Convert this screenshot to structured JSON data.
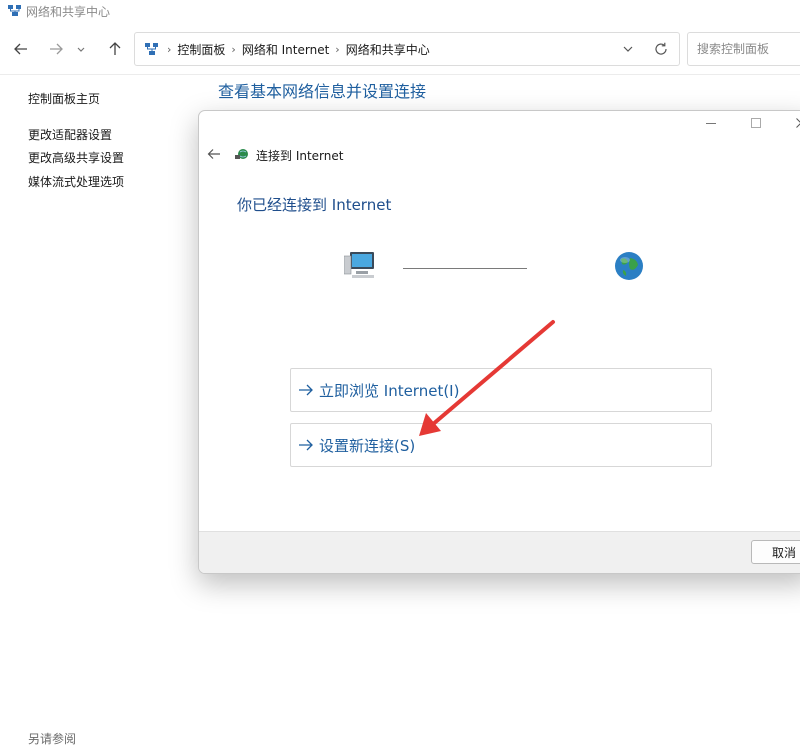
{
  "window": {
    "title": "网络和共享中心"
  },
  "toolbar": {
    "back_icon": "arrow-left-icon",
    "forward_icon": "arrow-right-icon",
    "recent_icon": "chevron-down-icon",
    "up_icon": "arrow-up-icon"
  },
  "address": {
    "crumbs": [
      "控制面板",
      "网络和 Internet",
      "网络和共享中心"
    ],
    "dropdown_icon": "chevron-down-icon",
    "refresh_icon": "refresh-icon"
  },
  "search": {
    "placeholder": "搜索控制面板"
  },
  "sidebar": {
    "home": "控制面板主页",
    "links": [
      "更改适配器设置",
      "更改高级共享设置",
      "媒体流式处理选项"
    ],
    "see_also": "另请参阅"
  },
  "main": {
    "heading": "查看基本网络信息并设置连接"
  },
  "dialog": {
    "title": "连接到 Internet",
    "heading": "你已经连接到 Internet",
    "options": [
      {
        "label": "立即浏览 Internet(I)"
      },
      {
        "label": "设置新连接(S)"
      }
    ],
    "cancel_label": "取消",
    "minimize_icon": "minimize-icon",
    "maximize_icon": "maximize-icon",
    "close_icon": "close-icon"
  },
  "colors": {
    "link_blue": "#1f5f9f",
    "annotation_red": "#e53935"
  }
}
